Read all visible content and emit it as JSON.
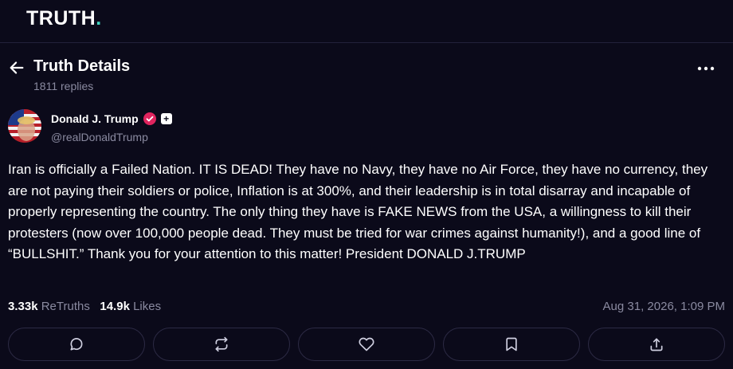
{
  "brand": {
    "logo_text": "TRUTH",
    "logo_dot": ".",
    "accent": "#3fd6c1"
  },
  "header": {
    "title": "Truth Details",
    "replies": "1811 replies"
  },
  "author": {
    "name": "Donald J. Trump",
    "handle": "@realDonaldTrump",
    "verified_color": "#e0245e"
  },
  "post": {
    "text": "Iran is officially a Failed Nation. IT IS DEAD! They have no Navy, they have no Air Force, they have no currency, they are not paying their soldiers or police, Inflation is at 300%, and their leadership is in total disarray and incapable of properly representing the country. The only thing they have is FAKE NEWS from the USA, a willingness to kill their protesters (now over 100,000 people dead. They must be tried for war crimes against humanity!), and a good line of “BULLSHIT.” Thank you for your attention to this matter! President DONALD J.TRUMP",
    "retruths_count": "3.33k",
    "retruths_label": "ReTruths",
    "likes_count": "14.9k",
    "likes_label": "Likes",
    "timestamp": "Aug 31, 2026, 1:09 PM"
  },
  "actions": [
    "reply-icon",
    "retruth-icon",
    "like-icon",
    "bookmark-icon",
    "share-icon"
  ]
}
